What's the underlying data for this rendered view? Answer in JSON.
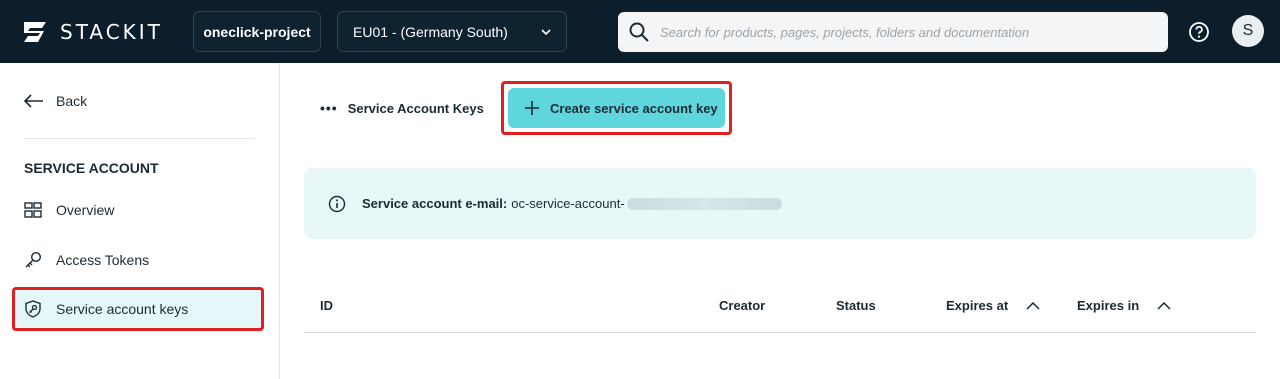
{
  "header": {
    "logo_text": "STACKIT",
    "project": "oneclick-project",
    "region": "EU01 - (Germany South)",
    "search_placeholder": "Search for products, pages, projects, folders and documentation",
    "avatar_initial": "S"
  },
  "sidebar": {
    "back_label": "Back",
    "section_title": "SERVICE ACCOUNT",
    "items": [
      {
        "label": "Overview",
        "icon": "grid-icon"
      },
      {
        "label": "Access Tokens",
        "icon": "key-icon"
      },
      {
        "label": "Service account keys",
        "icon": "shield-key-icon",
        "active": true
      }
    ]
  },
  "main": {
    "breadcrumb": "Service Account Keys",
    "create_button": "Create service account key",
    "info": {
      "label": "Service account e-mail:",
      "email_prefix": "oc-service-account-"
    },
    "table": {
      "columns": [
        "ID",
        "Creator",
        "Status",
        "Expires at",
        "Expires in"
      ]
    }
  },
  "colors": {
    "topbar": "#0c1e2b",
    "accent": "#5fd6dc",
    "highlight": "#e01f1f",
    "info_bg": "#e8f8f9"
  }
}
